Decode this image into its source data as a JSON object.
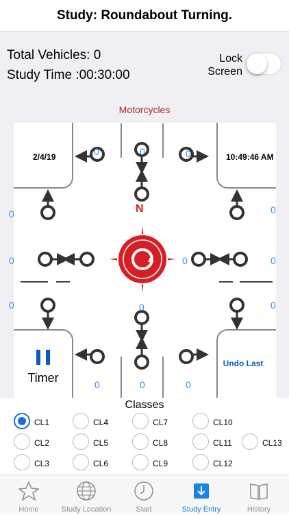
{
  "header": {
    "title": "Study: Roundabout Turning."
  },
  "stats": {
    "total_vehicles": "Total Vehicles: 0",
    "study_time": "Study Time :00:30:00"
  },
  "lock": {
    "label_line1": "Lock",
    "label_line2": "Screen"
  },
  "vehicle_class": "Motorcycles",
  "board": {
    "date": "2/4/19",
    "time": "10:49:46 AM",
    "compass_letter": "N",
    "timer_label": "Timer",
    "undo_label": "Undo Last",
    "counts": {
      "top_left": "0",
      "top_mid": "0",
      "top_right": "0",
      "left_top": "0",
      "left_mid": "0",
      "left_bot": "0",
      "right_top": "0",
      "right_mid": "0",
      "right_bot": "0",
      "center_right": "0",
      "center_bottom": "0",
      "bottom_left": "0",
      "bottom_mid": "0",
      "bottom_right": "0"
    }
  },
  "classes": {
    "title": "Classes",
    "items": [
      "CL1",
      "CL2",
      "CL3",
      "CL4",
      "CL5",
      "CL6",
      "CL7",
      "CL8",
      "CL9",
      "CL10",
      "CL11",
      "CL12",
      "CL13"
    ],
    "selected": "CL1"
  },
  "tabs": [
    {
      "label": "Home",
      "icon": "star-icon"
    },
    {
      "label": "Study Location",
      "icon": "globe-icon"
    },
    {
      "label": "Start",
      "icon": "clock-icon"
    },
    {
      "label": "Study Entry",
      "icon": "download-icon",
      "active": true
    },
    {
      "label": "History",
      "icon": "book-icon"
    }
  ],
  "colors": {
    "accent": "#1a82e2",
    "compass": "#d81e25",
    "vehicle_class": "#b0272a",
    "count": "#3a8ee6"
  }
}
